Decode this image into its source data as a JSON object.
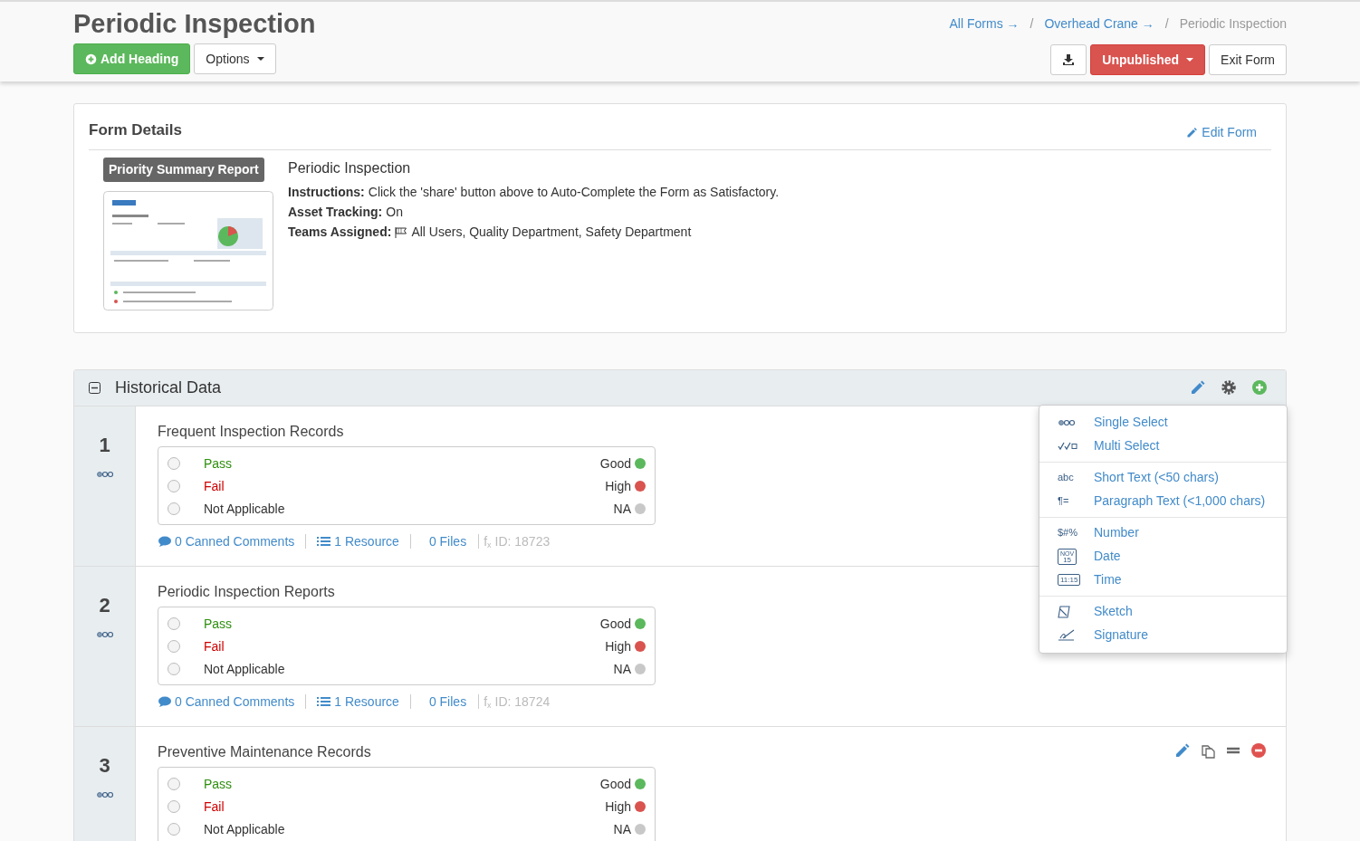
{
  "header": {
    "title": "Periodic Inspection",
    "add_button": "Add Heading",
    "options_button": "Options",
    "breadcrumbs": [
      {
        "label": "All Forms",
        "arrow": "→",
        "separator": "/",
        "link": true
      },
      {
        "label": "Overhead Crane",
        "arrow": "→",
        "separator": "/",
        "link": true
      },
      {
        "label": "Periodic Inspection",
        "link": false
      }
    ],
    "status_button": "Unpublished",
    "exit_button": "Exit Form"
  },
  "form_details": {
    "title": "Form Details",
    "edit_link": "Edit Form",
    "report_badge": "Priority Summary Report",
    "form_name": "Periodic Inspection",
    "details": [
      {
        "label": "Instructions:",
        "value": "Click the 'share' button above to Auto-Complete the Form as Satisfactory."
      },
      {
        "label": "Asset Tracking:",
        "value": "On"
      },
      {
        "label": "Teams Assigned:",
        "value": "All Users, Quality Department, Safety Department",
        "flag": true
      }
    ]
  },
  "section": {
    "title": "Historical Data",
    "expanded": true,
    "questions": [
      {
        "number": "1",
        "title": "Frequent Inspection Records",
        "hovered": false,
        "options": [
          {
            "label": "Pass",
            "kind": "pass",
            "rating": "Good",
            "color": "#5cb85c",
            "selected": false
          },
          {
            "label": "Fail",
            "kind": "fail",
            "rating": "High",
            "color": "#d9534f",
            "selected": false
          },
          {
            "label": "Not Applicable",
            "kind": "neutral",
            "rating": "NA",
            "color": "#c8c8c8",
            "selected": false
          }
        ],
        "comments": "0 Canned Comments",
        "resources": "1 Resource",
        "files": "0 Files",
        "formula": "f$_{x}$",
        "id": "ID: 18723"
      },
      {
        "number": "2",
        "title": "Periodic Inspection Reports",
        "hovered": false,
        "options": [
          {
            "label": "Pass",
            "kind": "pass",
            "rating": "Good",
            "color": "#5cb85c",
            "selected": false
          },
          {
            "label": "Fail",
            "kind": "fail",
            "rating": "High",
            "color": "#d9534f",
            "selected": false
          },
          {
            "label": "Not Applicable",
            "kind": "neutral",
            "rating": "NA",
            "color": "#c8c8c8",
            "selected": false
          }
        ],
        "comments": "0 Canned Comments",
        "resources": "1 Resource",
        "files": "0 Files",
        "formula": "f$_{x}$",
        "id": "ID: 18724"
      },
      {
        "number": "3",
        "title": "Preventive Maintenance Records",
        "hovered": true,
        "options": [
          {
            "label": "Pass",
            "kind": "pass",
            "rating": "Good",
            "color": "#5cb85c",
            "selected": false
          },
          {
            "label": "Fail",
            "kind": "fail",
            "rating": "High",
            "color": "#d9534f",
            "selected": false
          },
          {
            "label": "Not Applicable",
            "kind": "neutral",
            "rating": "NA",
            "color": "#c8c8c8",
            "selected": false
          }
        ]
      }
    ]
  },
  "add_menu": {
    "groups": [
      [
        {
          "kind": "single",
          "label": "Single Select"
        },
        {
          "kind": "multi",
          "label": "Multi Select"
        }
      ],
      [
        {
          "kind": "text",
          "glyph": "abc",
          "label": "Short Text (<50 chars)"
        },
        {
          "kind": "text",
          "glyph": "¶=",
          "label": "Paragraph Text (<1,000 chars)"
        }
      ],
      [
        {
          "kind": "text",
          "glyph": "$#%",
          "label": "Number"
        },
        {
          "kind": "calendar",
          "glyph_top": "NOV",
          "glyph": "15",
          "label": "Date"
        },
        {
          "kind": "clock",
          "glyph": "11:15",
          "label": "Time"
        }
      ],
      [
        {
          "kind": "sketch",
          "label": "Sketch"
        },
        {
          "kind": "signature",
          "label": "Signature"
        }
      ]
    ]
  }
}
